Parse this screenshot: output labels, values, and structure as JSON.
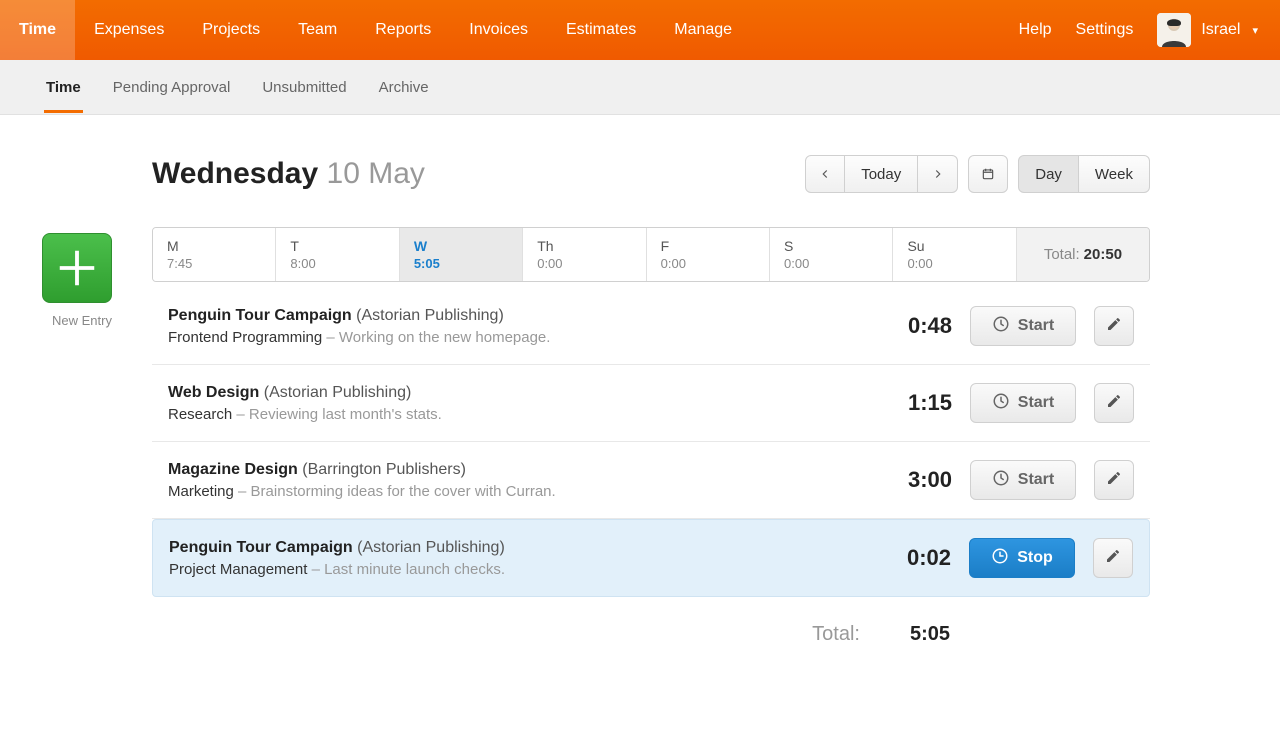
{
  "nav": {
    "items": [
      "Time",
      "Expenses",
      "Projects",
      "Team",
      "Reports",
      "Invoices",
      "Estimates",
      "Manage"
    ],
    "active_index": 0,
    "help": "Help",
    "settings": "Settings",
    "user_name": "Israel"
  },
  "tabs": {
    "items": [
      "Time",
      "Pending Approval",
      "Unsubmitted",
      "Archive"
    ],
    "active_index": 0
  },
  "header": {
    "day_name": "Wednesday",
    "date_rest": "10 May",
    "today_label": "Today",
    "day_label": "Day",
    "week_label": "Week"
  },
  "new_entry_label": "New Entry",
  "week": {
    "days": [
      {
        "abbr": "M",
        "dur": "7:45",
        "selected": false
      },
      {
        "abbr": "T",
        "dur": "8:00",
        "selected": false
      },
      {
        "abbr": "W",
        "dur": "5:05",
        "selected": true
      },
      {
        "abbr": "Th",
        "dur": "0:00",
        "selected": false
      },
      {
        "abbr": "F",
        "dur": "0:00",
        "selected": false
      },
      {
        "abbr": "S",
        "dur": "0:00",
        "selected": false
      },
      {
        "abbr": "Su",
        "dur": "0:00",
        "selected": false
      }
    ],
    "total_label": "Total:",
    "total_value": "20:50"
  },
  "entries": [
    {
      "project": "Penguin Tour Campaign",
      "client": "(Astorian Publishing)",
      "task": "Frontend Programming",
      "note": "Working on the new homepage.",
      "duration": "0:48",
      "running": false,
      "action_label": "Start"
    },
    {
      "project": "Web Design",
      "client": "(Astorian Publishing)",
      "task": "Research",
      "note": "Reviewing last month's stats.",
      "duration": "1:15",
      "running": false,
      "action_label": "Start"
    },
    {
      "project": "Magazine Design",
      "client": "(Barrington Publishers)",
      "task": "Marketing",
      "note": "Brainstorming ideas for the cover with Curran.",
      "duration": "3:00",
      "running": false,
      "action_label": "Start"
    },
    {
      "project": "Penguin Tour Campaign",
      "client": "(Astorian Publishing)",
      "task": "Project Management",
      "note": "Last minute launch checks.",
      "duration": "0:02",
      "running": true,
      "action_label": "Stop"
    }
  ],
  "footer": {
    "total_label": "Total:",
    "total_value": "5:05"
  },
  "sep": "  –  "
}
